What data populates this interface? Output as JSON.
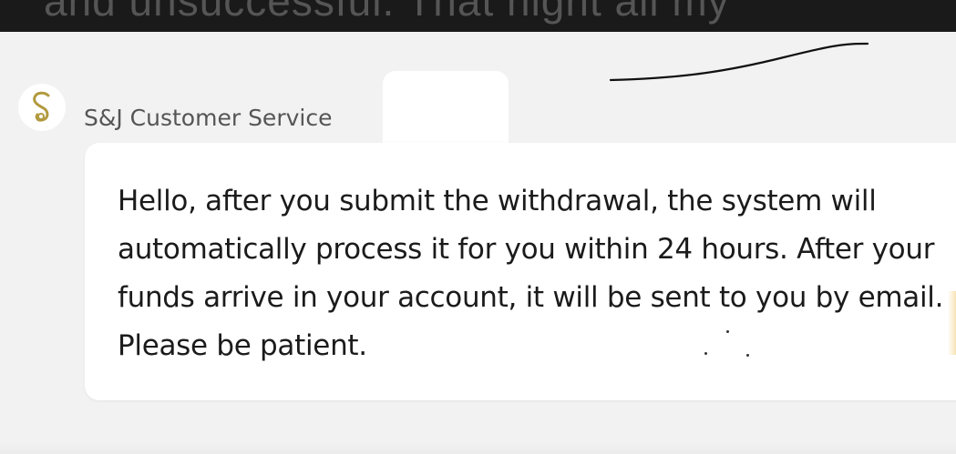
{
  "background_text": "and unsuccessful. That night all my",
  "sender": {
    "name": "S&J Customer Service",
    "avatar_icon": "s-monogram-icon",
    "avatar_color": "#b29a3f"
  },
  "message": {
    "text": "Hello, after you submit the withdrawal, the system will automatically process it for you within 24 hours. After your funds arrive in your account, it will be sent to you by email. Please be patient."
  },
  "colors": {
    "chat_background": "#f2f2f2",
    "bubble_background": "#ffffff",
    "top_strip": "#1a1a1a"
  }
}
